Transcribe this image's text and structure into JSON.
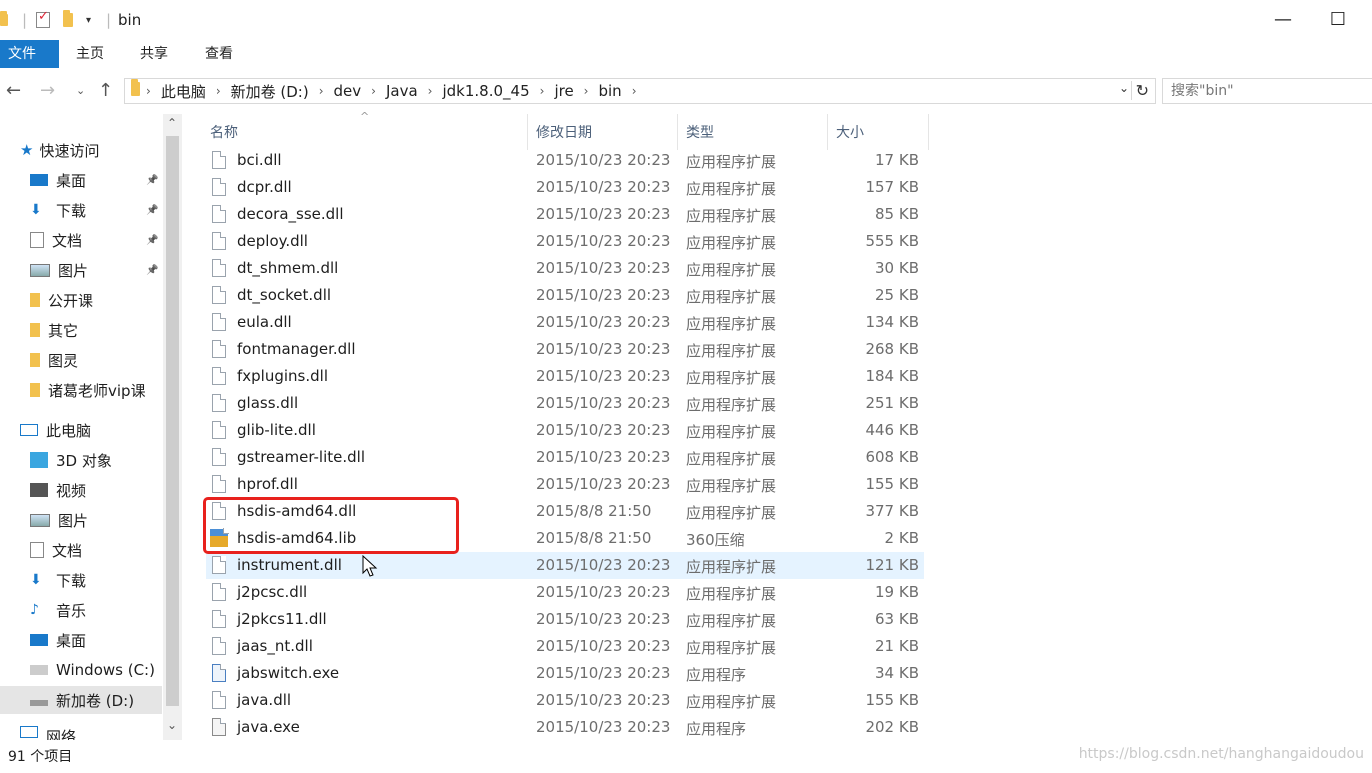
{
  "window": {
    "title": "bin",
    "minimize": "—",
    "maximize": "☐"
  },
  "ribbon": {
    "tabs": [
      "文件",
      "主页",
      "共享",
      "查看"
    ]
  },
  "address": {
    "crumbs": [
      "此电脑",
      "新加卷 (D:)",
      "dev",
      "Java",
      "jdk1.8.0_45",
      "jre",
      "bin"
    ],
    "search_placeholder": "搜索\"bin\""
  },
  "nav": {
    "quick_access": "快速访问",
    "quick_items": [
      {
        "label": "桌面",
        "icon": "desktop-icon",
        "pinned": true
      },
      {
        "label": "下载",
        "icon": "download-icon",
        "pinned": true
      },
      {
        "label": "文档",
        "icon": "document-icon",
        "pinned": true
      },
      {
        "label": "图片",
        "icon": "picture-icon",
        "pinned": true
      },
      {
        "label": "公开课",
        "icon": "folder-icon",
        "pinned": false
      },
      {
        "label": "其它",
        "icon": "folder-icon",
        "pinned": false
      },
      {
        "label": "图灵",
        "icon": "folder-icon",
        "pinned": false
      },
      {
        "label": "诸葛老师vip课",
        "icon": "folder-icon",
        "pinned": false
      }
    ],
    "this_pc": "此电脑",
    "pc_items": [
      {
        "label": "3D 对象",
        "icon": "3d-objects-icon"
      },
      {
        "label": "视频",
        "icon": "video-icon"
      },
      {
        "label": "图片",
        "icon": "picture-icon"
      },
      {
        "label": "文档",
        "icon": "document-icon"
      },
      {
        "label": "下载",
        "icon": "download-icon"
      },
      {
        "label": "音乐",
        "icon": "music-icon"
      },
      {
        "label": "桌面",
        "icon": "desktop-icon"
      },
      {
        "label": "Windows (C:)",
        "icon": "windows-drive-icon"
      },
      {
        "label": "新加卷 (D:)",
        "icon": "drive-icon"
      }
    ],
    "network": "网络"
  },
  "columns": {
    "name": "名称",
    "date": "修改日期",
    "type": "类型",
    "size": "大小"
  },
  "files": [
    {
      "name": "bci.dll",
      "date": "2015/10/23 20:23",
      "type": "应用程序扩展",
      "size": "17 KB",
      "icon": "dll"
    },
    {
      "name": "dcpr.dll",
      "date": "2015/10/23 20:23",
      "type": "应用程序扩展",
      "size": "157 KB",
      "icon": "dll"
    },
    {
      "name": "decora_sse.dll",
      "date": "2015/10/23 20:23",
      "type": "应用程序扩展",
      "size": "85 KB",
      "icon": "dll"
    },
    {
      "name": "deploy.dll",
      "date": "2015/10/23 20:23",
      "type": "应用程序扩展",
      "size": "555 KB",
      "icon": "dll"
    },
    {
      "name": "dt_shmem.dll",
      "date": "2015/10/23 20:23",
      "type": "应用程序扩展",
      "size": "30 KB",
      "icon": "dll"
    },
    {
      "name": "dt_socket.dll",
      "date": "2015/10/23 20:23",
      "type": "应用程序扩展",
      "size": "25 KB",
      "icon": "dll"
    },
    {
      "name": "eula.dll",
      "date": "2015/10/23 20:23",
      "type": "应用程序扩展",
      "size": "134 KB",
      "icon": "dll"
    },
    {
      "name": "fontmanager.dll",
      "date": "2015/10/23 20:23",
      "type": "应用程序扩展",
      "size": "268 KB",
      "icon": "dll"
    },
    {
      "name": "fxplugins.dll",
      "date": "2015/10/23 20:23",
      "type": "应用程序扩展",
      "size": "184 KB",
      "icon": "dll"
    },
    {
      "name": "glass.dll",
      "date": "2015/10/23 20:23",
      "type": "应用程序扩展",
      "size": "251 KB",
      "icon": "dll"
    },
    {
      "name": "glib-lite.dll",
      "date": "2015/10/23 20:23",
      "type": "应用程序扩展",
      "size": "446 KB",
      "icon": "dll"
    },
    {
      "name": "gstreamer-lite.dll",
      "date": "2015/10/23 20:23",
      "type": "应用程序扩展",
      "size": "608 KB",
      "icon": "dll"
    },
    {
      "name": "hprof.dll",
      "date": "2015/10/23 20:23",
      "type": "应用程序扩展",
      "size": "155 KB",
      "icon": "dll"
    },
    {
      "name": "hsdis-amd64.dll",
      "date": "2015/8/8 21:50",
      "type": "应用程序扩展",
      "size": "377 KB",
      "icon": "dll"
    },
    {
      "name": "hsdis-amd64.lib",
      "date": "2015/8/8 21:50",
      "type": "360压缩",
      "size": "2 KB",
      "icon": "lib"
    },
    {
      "name": "instrument.dll",
      "date": "2015/10/23 20:23",
      "type": "应用程序扩展",
      "size": "121 KB",
      "icon": "dll",
      "hover": true
    },
    {
      "name": "j2pcsc.dll",
      "date": "2015/10/23 20:23",
      "type": "应用程序扩展",
      "size": "19 KB",
      "icon": "dll"
    },
    {
      "name": "j2pkcs11.dll",
      "date": "2015/10/23 20:23",
      "type": "应用程序扩展",
      "size": "63 KB",
      "icon": "dll"
    },
    {
      "name": "jaas_nt.dll",
      "date": "2015/10/23 20:23",
      "type": "应用程序扩展",
      "size": "21 KB",
      "icon": "dll"
    },
    {
      "name": "jabswitch.exe",
      "date": "2015/10/23 20:23",
      "type": "应用程序",
      "size": "34 KB",
      "icon": "exe"
    },
    {
      "name": "java.dll",
      "date": "2015/10/23 20:23",
      "type": "应用程序扩展",
      "size": "155 KB",
      "icon": "dll"
    },
    {
      "name": "java.exe",
      "date": "2015/10/23 20:23",
      "type": "应用程序",
      "size": "202 KB",
      "icon": "java"
    }
  ],
  "status": {
    "item_count": "91 个项目",
    "watermark": "https://blog.csdn.net/hanghangaidoudou"
  }
}
